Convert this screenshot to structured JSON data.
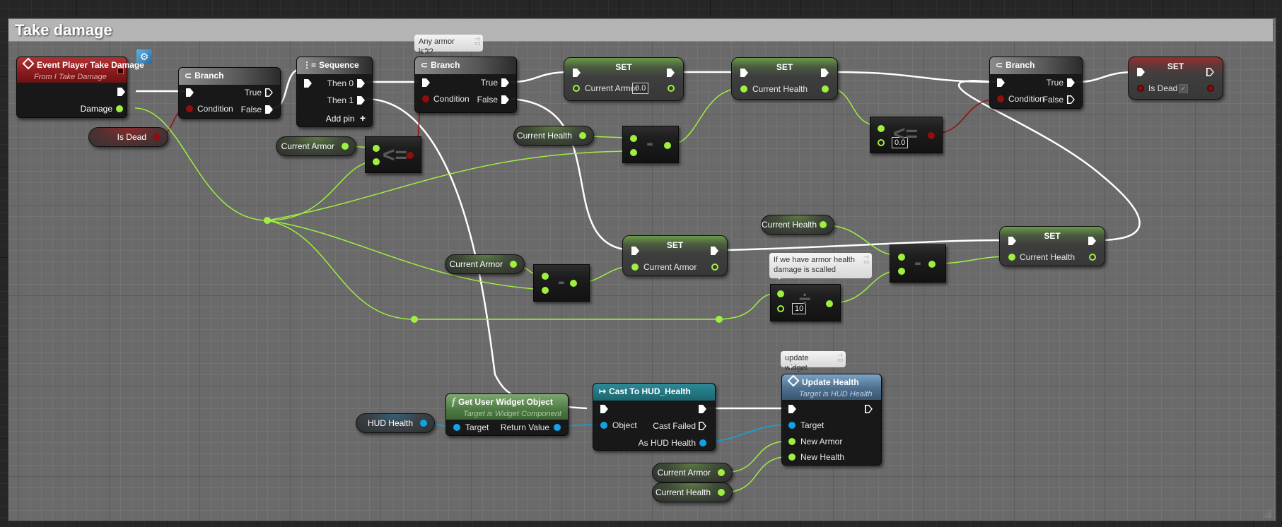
{
  "graph_title": "Take damage",
  "comments": {
    "armor_check": "Any armor left?",
    "scaled": "If we have armor health damage is scalled",
    "update_widget": "update widget"
  },
  "event_node": {
    "title": "Event Player Take Damage",
    "subtitle": "From I Take Damage",
    "output_pin": "Damage",
    "icon": "event-diamond-icon",
    "badge_icon": "interface-gear-icon"
  },
  "branch_dead": {
    "title": "Branch",
    "condition": "Condition",
    "true": "True",
    "false": "False"
  },
  "getter_is_dead": {
    "label": "Is Dead"
  },
  "sequence": {
    "title": "Sequence",
    "then0": "Then 0",
    "then1": "Then 1",
    "add_pin": "Add pin",
    "add_icon": "+"
  },
  "getter_armor_1": {
    "label": "Current Armor"
  },
  "compare_armor": {
    "symbol": "<="
  },
  "branch_armor": {
    "title": "Branch",
    "condition": "Condition",
    "true": "True",
    "false": "False"
  },
  "set_armor_zero": {
    "title": "SET",
    "var": "Current Armor",
    "value": "0.0"
  },
  "getter_health_1": {
    "label": "Current Health"
  },
  "subtract_health_1": {
    "symbol": "-"
  },
  "set_health_1": {
    "title": "SET",
    "var": "Current Health"
  },
  "compare_health": {
    "symbol": "<=",
    "value": "0.0"
  },
  "branch_health": {
    "title": "Branch",
    "condition": "Condition",
    "true": "True",
    "false": "False"
  },
  "set_is_dead": {
    "title": "SET",
    "var": "Is Dead",
    "checked": true,
    "check_glyph": "✓"
  },
  "getter_health_2": {
    "label": "Current Health"
  },
  "set_armor_2": {
    "title": "SET",
    "var": "Current Armor"
  },
  "getter_armor_2": {
    "label": "Current Armor"
  },
  "subtract_armor": {
    "symbol": "-"
  },
  "divide_node": {
    "symbol": "÷",
    "value": "10"
  },
  "subtract_health_2": {
    "symbol": "-"
  },
  "set_health_2": {
    "title": "SET",
    "var": "Current Health"
  },
  "getter_hud": {
    "label": "HUD Health"
  },
  "get_widget": {
    "title": "Get User Widget Object",
    "subtitle": "Target is Widget Component",
    "target": "Target",
    "return": "Return Value",
    "icon": "f"
  },
  "cast_node": {
    "title": "Cast To HUD_Health",
    "object": "Object",
    "failed": "Cast Failed",
    "as": "As HUD Health",
    "icon": "↦"
  },
  "update_health": {
    "title": "Update Health",
    "subtitle": "Target is HUD Health",
    "target": "Target",
    "new_armor": "New Armor",
    "new_health": "New Health"
  },
  "getter_armor_3": {
    "label": "Current Armor"
  },
  "getter_health_3": {
    "label": "Current Health"
  },
  "colors": {
    "float_pin": "#9fef3f",
    "bool_pin": "#940d0d",
    "object_pin": "#10a4e6",
    "exec_wire": "#ffffff"
  }
}
